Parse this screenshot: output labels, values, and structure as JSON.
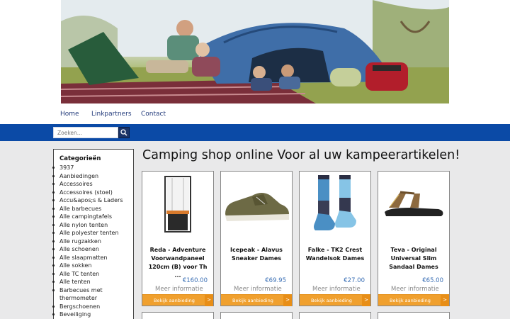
{
  "nav": {
    "items": [
      "Home",
      "Linkpartners",
      "Contact"
    ]
  },
  "search": {
    "placeholder": "Zoeken..."
  },
  "sidebar": {
    "title": "Categorieën",
    "items": [
      "3937",
      "Aanbiedingen",
      "Accessoires",
      "Accessoires (stoel)",
      "Accu&apos;s & Laders",
      "Alle barbecues",
      "Alle campingtafels",
      "Alle nylon tenten",
      "Alle polyester tenten",
      "Alle rugzakken",
      "Alle schoenen",
      "Alle slaapmatten",
      "Alle sokken",
      "Alle TC tenten",
      "Alle tenten",
      "Barbecues met thermometer",
      "Bergschoenen",
      "Beveiliging"
    ]
  },
  "main": {
    "title": "Camping shop online Voor al uw kampeerartikelen!",
    "products": [
      {
        "name": "Reda - Adventure Voorwandpaneel 120cm (B) voor Th ...",
        "price": "€160.00",
        "more": "Meer informatie",
        "deal": "Bekijk aanbieding",
        "arrow": ">"
      },
      {
        "name": "Icepeak - Alavus Sneaker Dames",
        "price": "€69.95",
        "more": "Meer informatie",
        "deal": "Bekijk aanbieding",
        "arrow": ">"
      },
      {
        "name": "Falke - TK2 Crest Wandelsok Dames",
        "price": "€27.00",
        "more": "Meer informatie",
        "deal": "Bekijk aanbieding",
        "arrow": ">"
      },
      {
        "name": "Teva - Original Universal Slim Sandaal Dames",
        "price": "€65.00",
        "more": "Meer informatie",
        "deal": "Bekijk aanbieding",
        "arrow": ">"
      }
    ]
  },
  "colors": {
    "blue_bar": "#0b4aa6",
    "price": "#3a6fb5",
    "deal_button": "#f0a02e"
  }
}
